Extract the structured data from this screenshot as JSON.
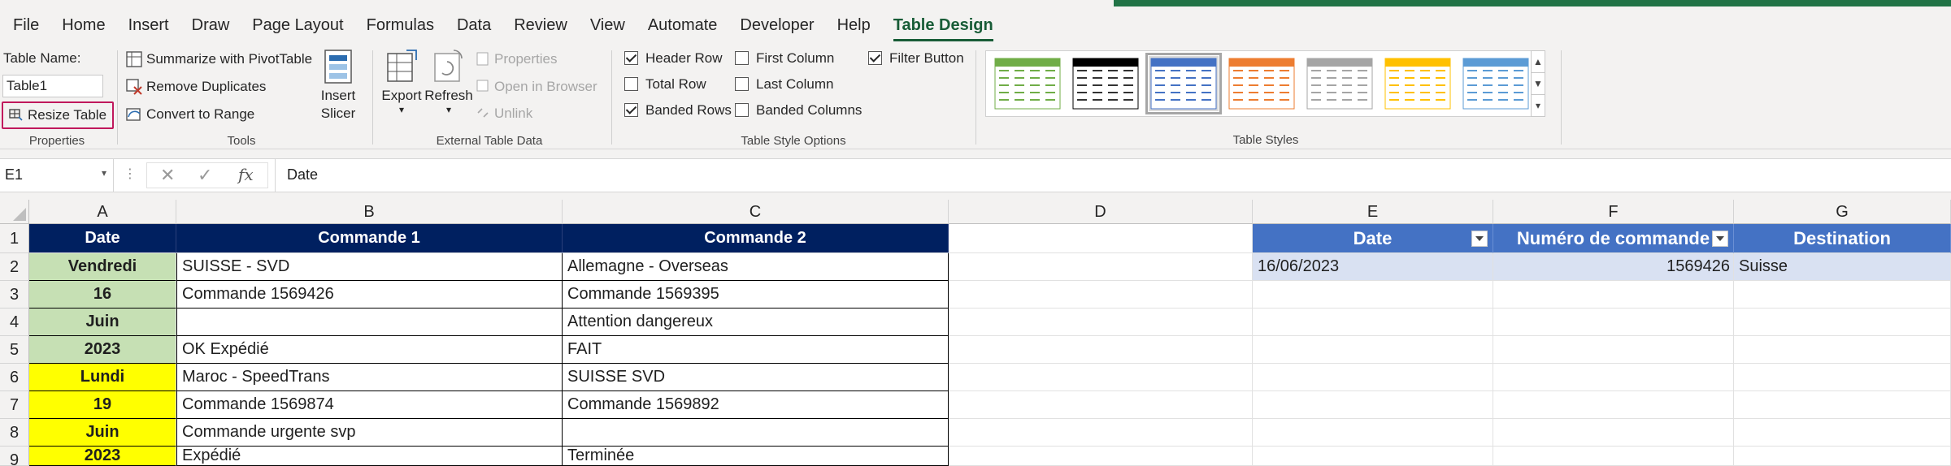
{
  "tabs": [
    "File",
    "Home",
    "Insert",
    "Draw",
    "Page Layout",
    "Formulas",
    "Data",
    "Review",
    "View",
    "Automate",
    "Developer",
    "Help",
    "Table Design"
  ],
  "properties": {
    "table_name_label": "Table Name:",
    "table_name_value": "Table1",
    "resize_label": "Resize Table",
    "group_label": "Properties"
  },
  "tools": {
    "summarize": "Summarize with PivotTable",
    "remove_dup": "Remove Duplicates",
    "convert": "Convert to Range",
    "slicer_line1": "Insert",
    "slicer_line2": "Slicer",
    "group_label": "Tools"
  },
  "external": {
    "export": "Export",
    "refresh": "Refresh",
    "properties": "Properties",
    "open_browser": "Open in Browser",
    "unlink": "Unlink",
    "group_label": "External Table Data"
  },
  "style_options": {
    "header_row": "Header Row",
    "total_row": "Total Row",
    "banded_rows": "Banded Rows",
    "first_column": "First Column",
    "last_column": "Last Column",
    "banded_columns": "Banded Columns",
    "filter_button": "Filter Button",
    "group_label": "Table Style Options"
  },
  "table_styles": {
    "group_label": "Table Styles",
    "swatch_colors": [
      "#70ad47",
      "#000000",
      "#4472c4",
      "#ed7d31",
      "#a5a5a5",
      "#ffc000",
      "#5b9bd5"
    ],
    "selected_index": 2
  },
  "formula_bar": {
    "name_box": "E1",
    "fx": "fx",
    "value": "Date"
  },
  "columns": [
    "A",
    "B",
    "C",
    "D",
    "E",
    "F",
    "G"
  ],
  "rows": [
    "1",
    "2",
    "3",
    "4",
    "5",
    "6",
    "7",
    "8",
    "9"
  ],
  "cells": {
    "A": [
      "Date",
      "Vendredi",
      "16",
      "Juin",
      "2023",
      "Lundi",
      "19",
      "Juin",
      "2023"
    ],
    "B": [
      "Commande 1",
      "SUISSE - SVD",
      "Commande 1569426",
      "",
      "OK Expédié",
      "Maroc - SpeedTrans",
      "Commande 1569874",
      "Commande urgente svp",
      "Expédié"
    ],
    "C": [
      "Commande 2",
      "Allemagne - Overseas",
      "Commande 1569395",
      "Attention dangereux",
      "FAIT",
      "SUISSE SVD",
      "Commande 1569892",
      "",
      "Terminée"
    ],
    "E": [
      "Date",
      "16/06/2023"
    ],
    "F": [
      "Numéro de commande",
      "1569426"
    ],
    "G": [
      "Destination",
      "Suisse"
    ]
  }
}
